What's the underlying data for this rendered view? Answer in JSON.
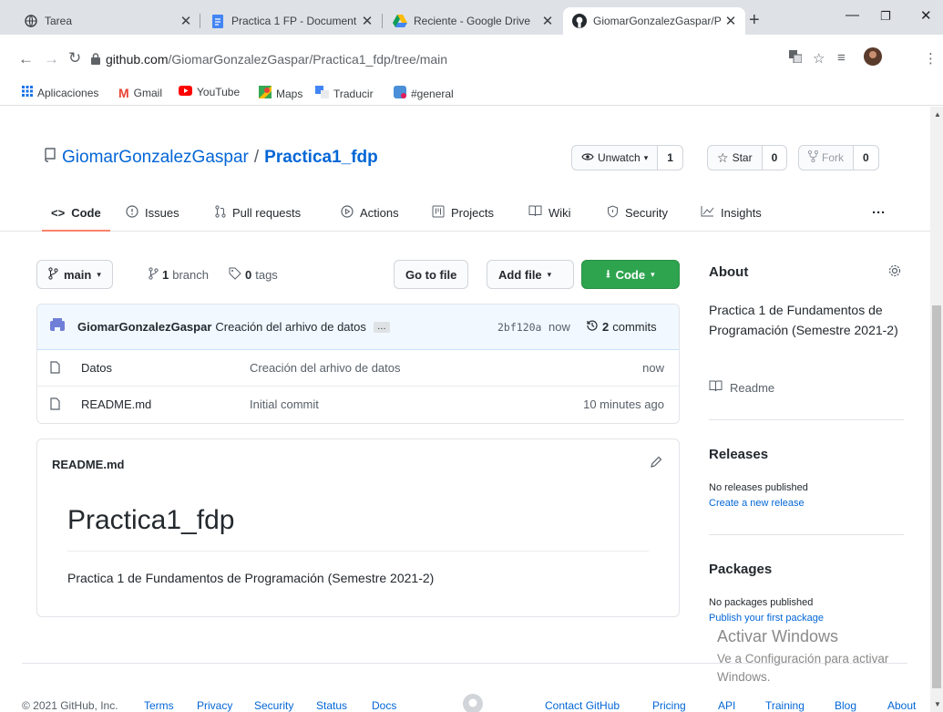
{
  "browser": {
    "tabs": [
      {
        "title": "Tarea",
        "icon": "globe-icon"
      },
      {
        "title": "Practica 1 FP - Document",
        "icon": "docs-icon"
      },
      {
        "title": "Reciente - Google Drive",
        "icon": "drive-icon"
      },
      {
        "title": "GiomarGonzalezGaspar/P",
        "icon": "github-icon",
        "active": true
      }
    ],
    "new_tab": "+",
    "url_host": "github.com",
    "url_path": "/GiomarGonzalezGaspar/Practica1_fdp/tree/main",
    "bookmarks": [
      "Aplicaciones",
      "Gmail",
      "YouTube",
      "Maps",
      "Traducir",
      "#general"
    ]
  },
  "repo": {
    "owner": "GiomarGonzalezGaspar",
    "separator": "/",
    "name": "Practica1_fdp",
    "watch_label": "Unwatch",
    "watch_count": "1",
    "star_label": "Star",
    "star_count": "0",
    "fork_label": "Fork",
    "fork_count": "0"
  },
  "nav": {
    "tabs": [
      "Code",
      "Issues",
      "Pull requests",
      "Actions",
      "Projects",
      "Wiki",
      "Security",
      "Insights"
    ],
    "more": "···"
  },
  "filebar": {
    "branch": "main",
    "branch_count": "1",
    "branch_label": "branch",
    "tag_count": "0",
    "tag_label": "tags",
    "goto_file": "Go to file",
    "add_file": "Add file",
    "code": "Code"
  },
  "commit": {
    "author": "GiomarGonzalezGaspar",
    "message": "Creación del arhivo de datos",
    "ellipsis": "…",
    "sha": "2bf120a",
    "time": "now",
    "count": "2",
    "count_label": "commits"
  },
  "files": [
    {
      "name": "Datos",
      "message": "Creación del arhivo de datos",
      "time": "now",
      "type": "file"
    },
    {
      "name": "README.md",
      "message": "Initial commit",
      "time": "10 minutes ago",
      "type": "file"
    }
  ],
  "readme": {
    "filename": "README.md",
    "heading": "Practica1_fdp",
    "body": "Practica 1 de Fundamentos de Programación (Semestre 2021-2)"
  },
  "sidebar": {
    "about_title": "About",
    "about_desc": "Practica 1 de Fundamentos de Programación (Semestre 2021-2)",
    "readme_link": "Readme",
    "releases_title": "Releases",
    "releases_none": "No releases published",
    "releases_create": "Create a new release",
    "packages_title": "Packages",
    "packages_none": "No packages published",
    "packages_publish": "Publish your first package"
  },
  "footer": {
    "copyright": "© 2021 GitHub, Inc.",
    "links_left": [
      "Terms",
      "Privacy",
      "Security",
      "Status",
      "Docs"
    ],
    "links_right": [
      "Contact GitHub",
      "Pricing",
      "API",
      "Training",
      "Blog",
      "About"
    ]
  },
  "watermark": {
    "title": "Activar Windows",
    "line1": "Ve a Configuración para activar",
    "line2": "Windows."
  },
  "colors": {
    "link": "#0366d6",
    "primary_button": "#2ea44f",
    "nav_underline": "#f9826c",
    "commit_bg": "#f1f8ff"
  }
}
